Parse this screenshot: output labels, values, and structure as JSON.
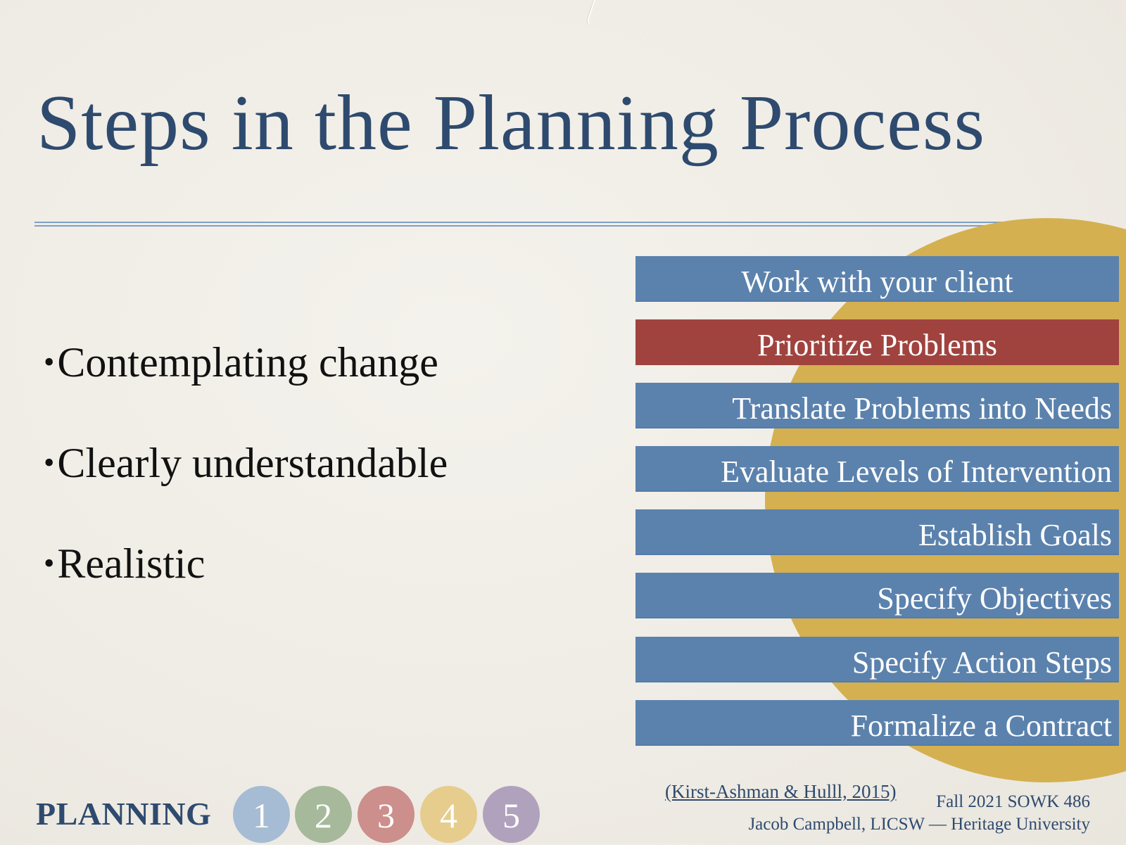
{
  "slide": {
    "title": "Steps in the Planning Process",
    "bullets": [
      "Contemplating change",
      "Clearly understandable",
      "Realistic"
    ],
    "bullet_glyph": "•",
    "steps": [
      {
        "label": "Work with your client",
        "color": "#5b82ad",
        "highlighted": false
      },
      {
        "label": "Prioritize Problems",
        "color": "#a0433f",
        "highlighted": true
      },
      {
        "label": "Translate Problems into Needs",
        "color": "#5b82ad",
        "highlighted": false
      },
      {
        "label": "Evaluate Levels of Intervention",
        "color": "#5b82ad",
        "highlighted": false
      },
      {
        "label": "Establish Goals",
        "color": "#5b82ad",
        "highlighted": false
      },
      {
        "label": "Specify Objectives",
        "color": "#5b82ad",
        "highlighted": false
      },
      {
        "label": "Specify Action Steps",
        "color": "#5b82ad",
        "highlighted": false
      },
      {
        "label": "Formalize a Contract",
        "color": "#5b82ad",
        "highlighted": false
      }
    ],
    "citation": "(Kirst-Ashman & Hulll, 2015)",
    "course": "Fall 2021 SOWK 486",
    "author": "Jacob Campbell, LICSW — Heritage University"
  },
  "footer_nav": {
    "label": "PLANNING",
    "phases": [
      {
        "number": "1",
        "color": "#a6bcd4"
      },
      {
        "number": "2",
        "color": "#a6b99a"
      },
      {
        "number": "3",
        "color": "#cc8f8b"
      },
      {
        "number": "4",
        "color": "#e6cd8e"
      },
      {
        "number": "5",
        "color": "#b0a2bd"
      }
    ]
  },
  "colors": {
    "title": "#2e4a6e",
    "step_blue": "#5b82ad",
    "step_red": "#a0433f",
    "accent_gold": "#d4b050",
    "rule": "#7f9fc6"
  }
}
